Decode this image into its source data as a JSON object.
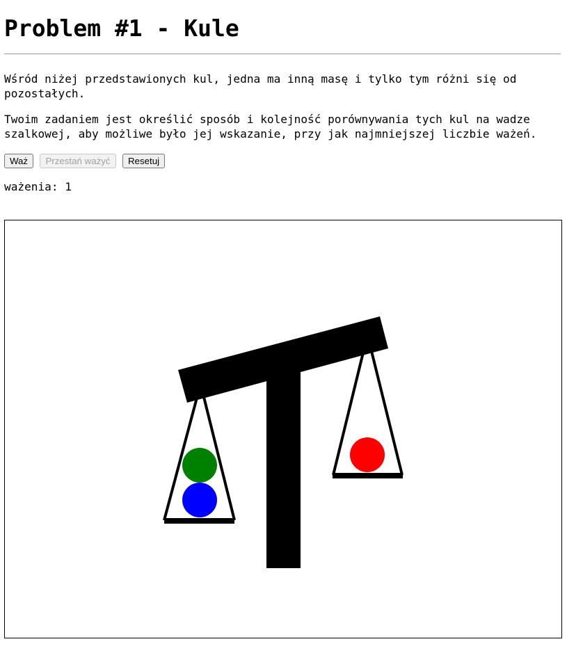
{
  "title": "Problem #1 - Kule",
  "description": {
    "paragraph1": "Wśród niżej przedstawionych kul, jedna ma inną masę i tylko tym różni się od pozostałych.",
    "paragraph2": "Twoim zadaniem jest określić sposób i kolejność porównywania tych kul na wadze szalkowej, aby możliwe było jej wskazanie, przy jak najmniejszej liczbie ważeń."
  },
  "controls": {
    "weigh_label": "Waż",
    "stop_label": "Przestań ważyć",
    "stop_disabled": true,
    "reset_label": "Resetuj"
  },
  "counter": {
    "label": "ważenia:",
    "value": "1"
  },
  "scale": {
    "left_pan_balls": [
      {
        "color": "#008000",
        "name": "green"
      },
      {
        "color": "#0000ff",
        "name": "blue"
      }
    ],
    "right_pan_balls": [
      {
        "color": "#ff0000",
        "name": "red"
      }
    ],
    "tilt": "left-down"
  }
}
